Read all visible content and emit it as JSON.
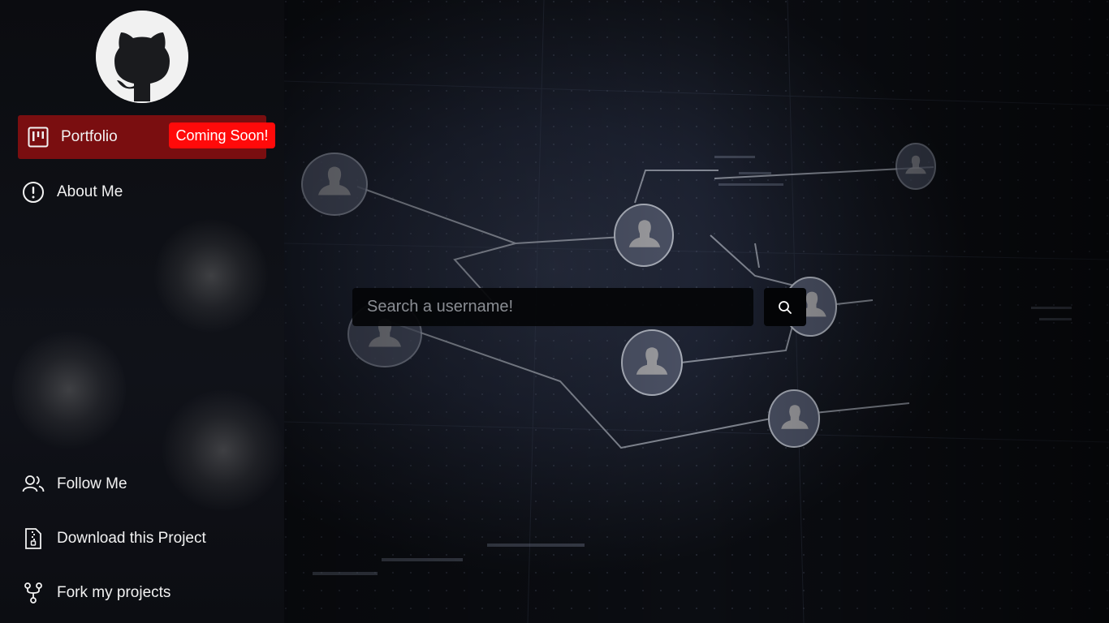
{
  "sidebar": {
    "logo_icon": "github-octocat-icon",
    "items": [
      {
        "label": "Portfolio",
        "icon": "kanban-board-icon",
        "active": true,
        "badge": "Coming Soon!"
      },
      {
        "label": "About Me",
        "icon": "exclamation-circle-icon"
      },
      {
        "label": "Follow Me",
        "icon": "people-icon"
      },
      {
        "label": "Download this Project",
        "icon": "file-zip-icon"
      },
      {
        "label": "Fork my projects",
        "icon": "git-fork-icon"
      }
    ]
  },
  "search": {
    "placeholder": "Search a username!",
    "value": "",
    "button_icon": "search-icon"
  },
  "colors": {
    "active_item_bg": "#7a0e10",
    "badge_bg": "#ff0a0a",
    "sidebar_bg": "#0e1016",
    "background": "#1c2130"
  }
}
